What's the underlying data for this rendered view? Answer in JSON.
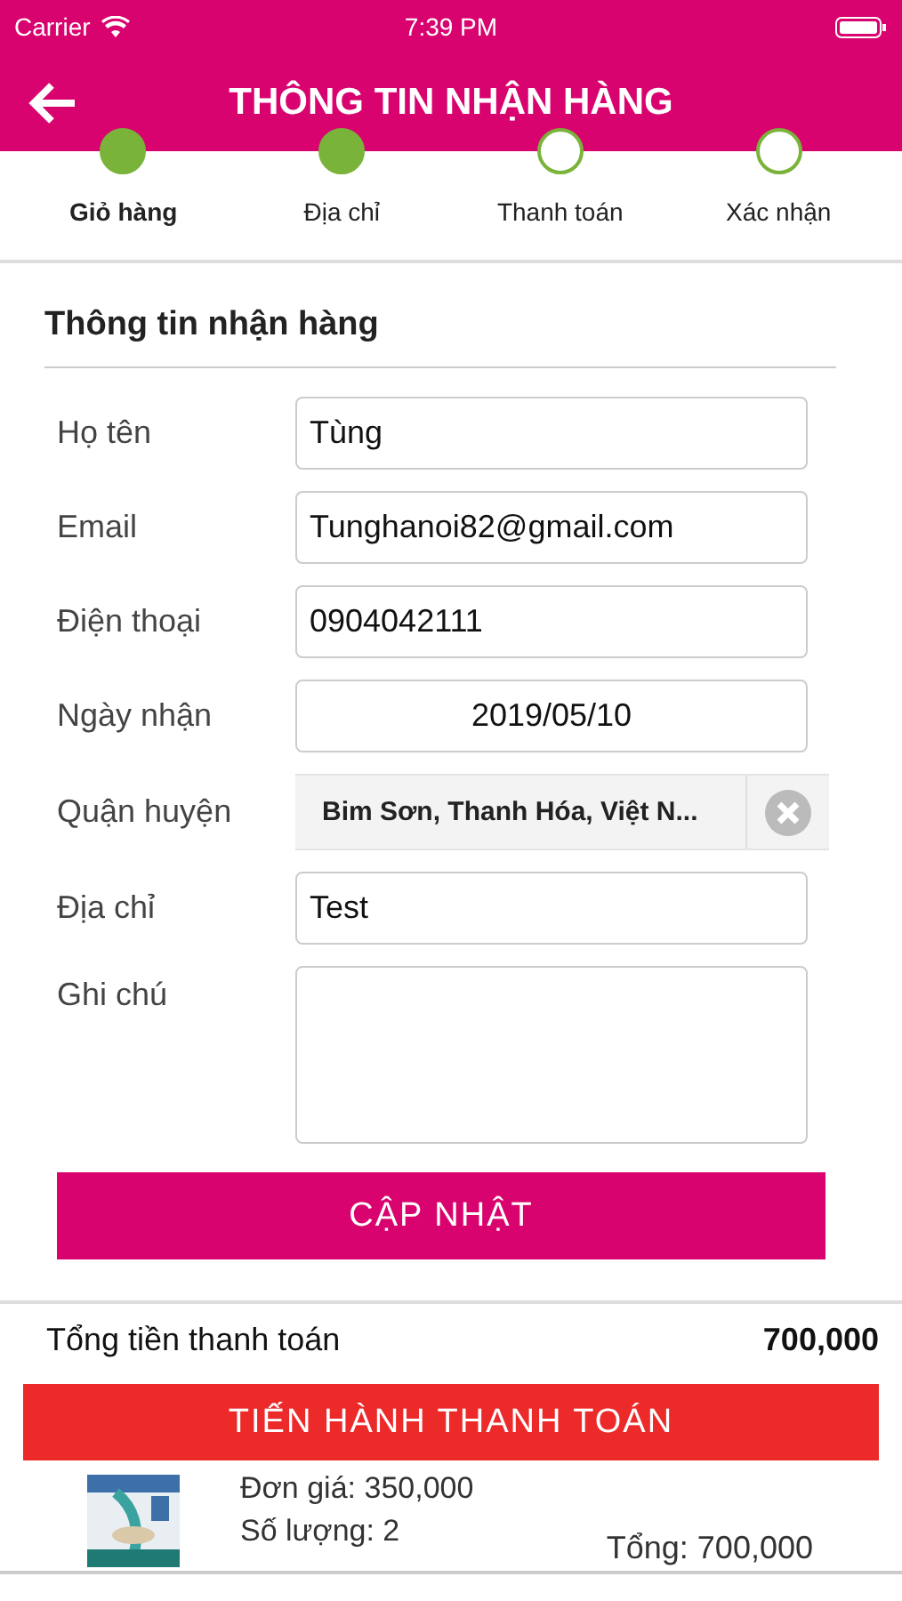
{
  "status_bar": {
    "carrier": "Carrier",
    "time": "7:39 PM"
  },
  "header": {
    "title": "THÔNG TIN NHẬN HÀNG"
  },
  "steps": [
    {
      "label": "Giỏ hàng",
      "done": true,
      "selected": true
    },
    {
      "label": "Địa chỉ",
      "done": true,
      "selected": false
    },
    {
      "label": "Thanh toán",
      "done": false,
      "selected": false
    },
    {
      "label": "Xác nhận",
      "done": false,
      "selected": false
    }
  ],
  "section_title": "Thông tin nhận hàng",
  "fields": [
    {
      "kind": "text",
      "label": "Họ tên",
      "value": "Tùng"
    },
    {
      "kind": "text",
      "label": "Email",
      "value": "Tunghanoi82@gmail.com"
    },
    {
      "kind": "text",
      "label": "Điện thoại",
      "value": "0904042111"
    },
    {
      "kind": "date",
      "label": "Ngày nhận",
      "value": "2019/05/10"
    },
    {
      "kind": "picker",
      "label": "Quận huyện",
      "value": "Bim Sơn, Thanh Hóa, Việt N..."
    },
    {
      "kind": "text",
      "label": "Địa chỉ",
      "value": "Test"
    },
    {
      "kind": "textarea",
      "label": "Ghi chú"
    }
  ],
  "update_button": "CẬP NHẬT",
  "total": {
    "label": "Tổng tiền thanh toán",
    "value": "700,000"
  },
  "checkout_button": "TIẾN HÀNH THANH TOÁN",
  "product": {
    "kind": "picture",
    "unit_price": "Đơn giá: 350,000",
    "quantity": "Số lượng: 2",
    "subtotal": "Tổng: 700,000"
  }
}
